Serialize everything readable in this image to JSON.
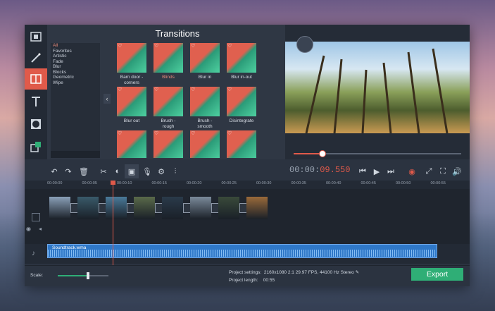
{
  "app": {
    "panel_title": "Transitions",
    "categories": [
      "All",
      "Favorites",
      "Artistic",
      "Fade",
      "Blur",
      "Blocks",
      "Geometric",
      "Wipe"
    ],
    "active_category_index": 0,
    "transitions": [
      {
        "label": "Barn door -\ncorners",
        "favorited": true
      },
      {
        "label": "Blinds",
        "favorited": true,
        "selected": true
      },
      {
        "label": "Blur in",
        "favorited": true
      },
      {
        "label": "Blur in-out",
        "favorited": true
      },
      {
        "label": "Blur out",
        "favorited": true
      },
      {
        "label": "Brush -\nrough",
        "favorited": true
      },
      {
        "label": "Brush -\nsmooth",
        "favorited": true
      },
      {
        "label": "Disintegrate",
        "favorited": true
      },
      {
        "label": "",
        "favorited": true
      },
      {
        "label": "",
        "favorited": true
      },
      {
        "label": "",
        "favorited": true
      },
      {
        "label": "",
        "favorited": true
      }
    ],
    "preview": {
      "seek_progress": 0.17
    },
    "toolbar": {
      "timecode_prefix": "00:00:",
      "timecode_highlight": "09.550"
    },
    "ruler_ticks": [
      "00:00:00",
      "00:00:05",
      "00:00:10",
      "00:00:15",
      "00:00:20",
      "00:00:25",
      "00:00:30",
      "00:00:35",
      "00:00:40",
      "00:00:45",
      "00:00:50",
      "00:00:55"
    ],
    "audio_clip": {
      "name": "Soundtrack.wma"
    },
    "bottom": {
      "scale_label": "Scale:",
      "scale_value": 0.6,
      "project_settings_label": "Project settings:",
      "project_settings_value": "2160x1080 2:1 29.97 FPS, 44100 Hz Stereo",
      "project_length_label": "Project length:",
      "project_length_value": "00:55",
      "export_label": "Export"
    },
    "colors": {
      "accent": "#e05a4a",
      "export": "#2fae76",
      "audio": "#2f78c8"
    }
  }
}
